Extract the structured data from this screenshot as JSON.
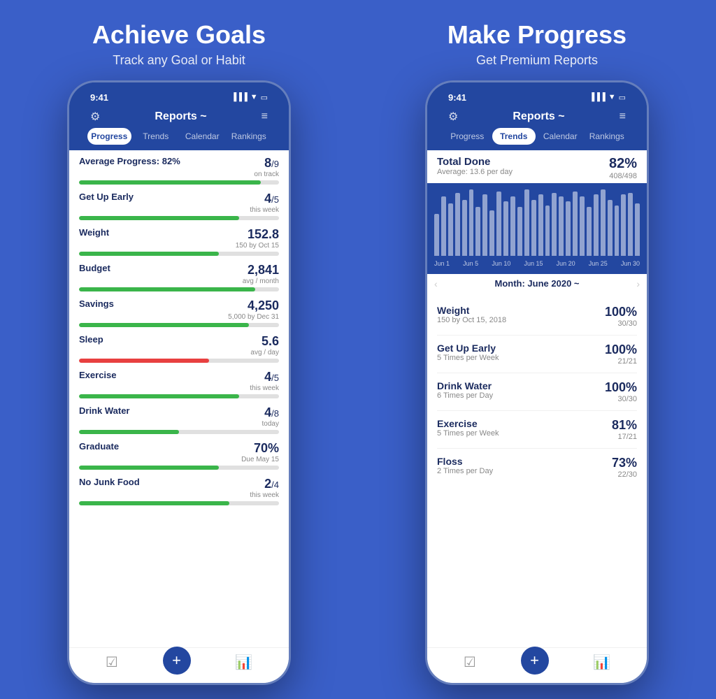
{
  "left": {
    "title": "Achieve Goals",
    "subtitle": "Track any Goal or Habit",
    "phone": {
      "time": "9:41",
      "nav_title": "Reports ~",
      "tabs": [
        "Progress",
        "Trends",
        "Calendar",
        "Rankings"
      ],
      "active_tab": 0,
      "items": [
        {
          "label": "Average Progress: 82%",
          "value": "8",
          "sub": "/9",
          "note": "on track",
          "pct": 91,
          "color": "green"
        },
        {
          "label": "Get Up Early",
          "value": "4",
          "sub": "/5",
          "note": "this week",
          "pct": 80,
          "color": "green"
        },
        {
          "label": "Weight",
          "value": "152.8",
          "sub": "",
          "note": "150 by Oct 15",
          "pct": 70,
          "color": "green"
        },
        {
          "label": "Budget",
          "value": "2,841",
          "sub": "",
          "note": "avg / month",
          "pct": 88,
          "color": "green"
        },
        {
          "label": "Savings",
          "value": "4,250",
          "sub": "",
          "note": "5,000 by Dec 31",
          "pct": 85,
          "color": "green"
        },
        {
          "label": "Sleep",
          "value": "5.6",
          "sub": "",
          "note": "avg / day",
          "pct": 65,
          "color": "red"
        },
        {
          "label": "Exercise",
          "value": "4",
          "sub": "/5",
          "note": "this week",
          "pct": 80,
          "color": "green"
        },
        {
          "label": "Drink Water",
          "value": "4",
          "sub": "/8",
          "note": "today",
          "pct": 50,
          "color": "green"
        },
        {
          "label": "Graduate",
          "value": "70%",
          "sub": "",
          "note": "Due May 15",
          "pct": 70,
          "color": "green"
        },
        {
          "label": "No Junk Food",
          "value": "2",
          "sub": "/4",
          "note": "this week",
          "pct": 75,
          "color": "green"
        }
      ]
    }
  },
  "right": {
    "title": "Make Progress",
    "subtitle": "Get Premium Reports",
    "phone": {
      "time": "9:41",
      "nav_title": "Reports ~",
      "tabs": [
        "Progress",
        "Trends",
        "Calendar",
        "Rankings"
      ],
      "active_tab": 1,
      "total_done": {
        "title": "Total Done",
        "sub": "Average: 13.6 per day",
        "pct": "82%",
        "frac": "408/498"
      },
      "chart_labels": [
        "Jun 1",
        "Jun 5",
        "Jun 10",
        "Jun 15",
        "Jun 20",
        "Jun 25",
        "Jun 30"
      ],
      "chart_bars": [
        60,
        85,
        75,
        90,
        80,
        95,
        70,
        88,
        65,
        92,
        78,
        85,
        70,
        95,
        80,
        88,
        72,
        90,
        85,
        78,
        92,
        85,
        70,
        88,
        95,
        80,
        72,
        88,
        90,
        75
      ],
      "month": "Month: June 2020 ~",
      "items": [
        {
          "name": "Weight",
          "desc": "150 by Oct 15, 2018",
          "pct": "100%",
          "frac": "30/30"
        },
        {
          "name": "Get Up Early",
          "desc": "5 Times per Week",
          "pct": "100%",
          "frac": "21/21"
        },
        {
          "name": "Drink Water",
          "desc": "6 Times per Day",
          "pct": "100%",
          "frac": "30/30"
        },
        {
          "name": "Exercise",
          "desc": "5 Times per Week",
          "pct": "81%",
          "frac": "17/21"
        },
        {
          "name": "Floss",
          "desc": "2 Times per Day",
          "pct": "73%",
          "frac": "22/30"
        }
      ]
    }
  }
}
